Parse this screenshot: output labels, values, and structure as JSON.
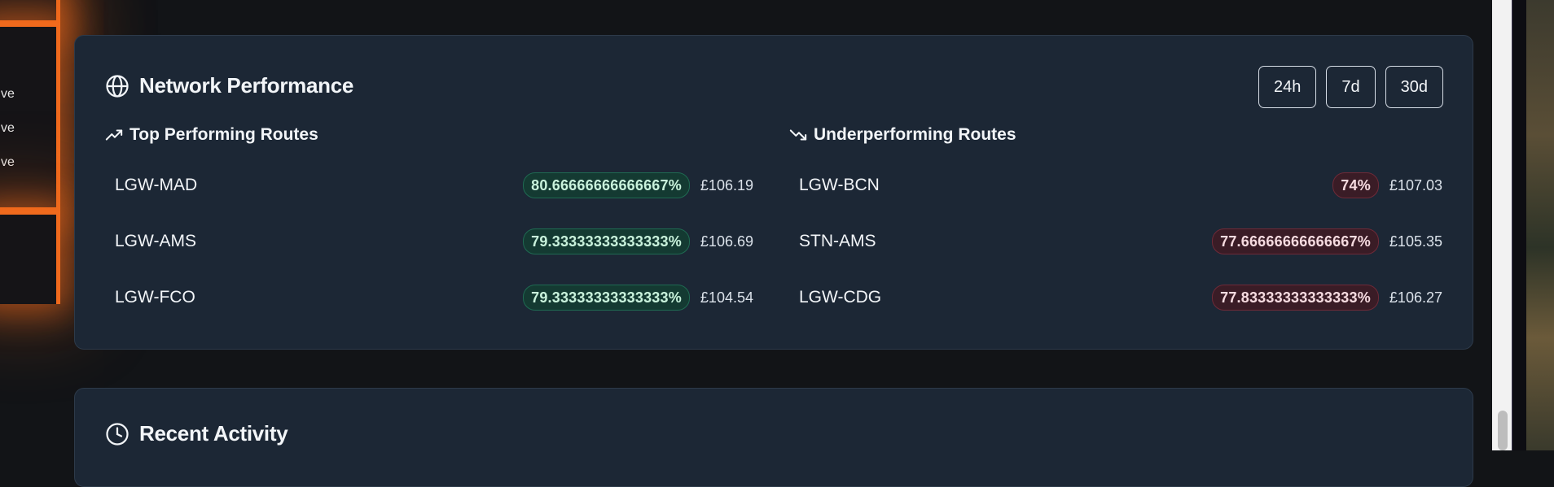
{
  "sidebar": {
    "status_items": [
      "ctive",
      "ctive",
      "ctive"
    ]
  },
  "network": {
    "title": "Network Performance",
    "ranges": [
      "24h",
      "7d",
      "30d"
    ],
    "top": {
      "heading": "Top Performing Routes",
      "routes": [
        {
          "name": "LGW-MAD",
          "score": "80.66666666666667%",
          "price": "£106.19"
        },
        {
          "name": "LGW-AMS",
          "score": "79.33333333333333%",
          "price": "£106.69"
        },
        {
          "name": "LGW-FCO",
          "score": "79.33333333333333%",
          "price": "£104.54"
        }
      ]
    },
    "under": {
      "heading": "Underperforming Routes",
      "routes": [
        {
          "name": "LGW-BCN",
          "score": "74%",
          "price": "£107.03"
        },
        {
          "name": "STN-AMS",
          "score": "77.66666666666667%",
          "price": "£105.35"
        },
        {
          "name": "LGW-CDG",
          "score": "77.83333333333333%",
          "price": "£106.27"
        }
      ]
    }
  },
  "recent": {
    "title": "Recent Activity"
  },
  "colors": {
    "accent_orange": "#f06a1d",
    "good": "#1f6a52",
    "bad": "#6e2a38"
  },
  "icons": [
    "globe-icon",
    "trending-up-icon",
    "trending-down-icon",
    "clock-icon"
  ]
}
